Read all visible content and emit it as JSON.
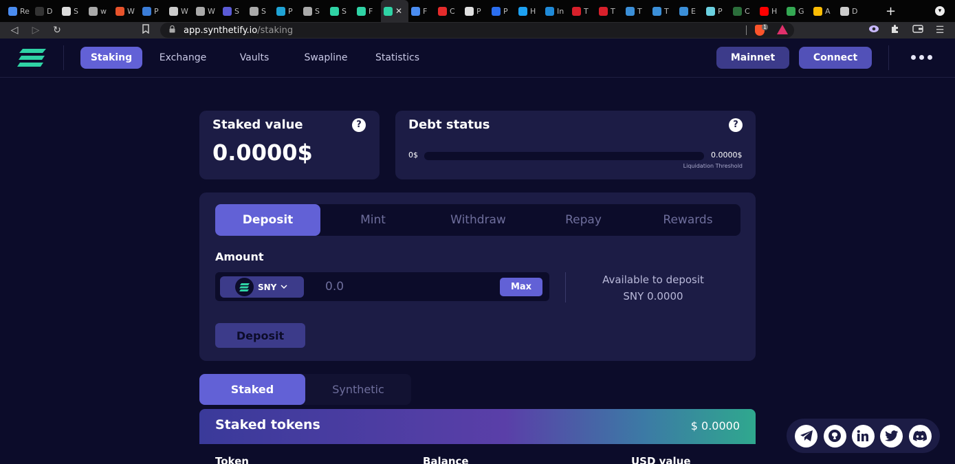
{
  "browser": {
    "tabs": [
      {
        "label": "Re",
        "color": "#4a8cf0"
      },
      {
        "label": "D",
        "color": "#333333"
      },
      {
        "label": "S",
        "color": "#dddddd"
      },
      {
        "label": "w",
        "color": "#aaaaaa"
      },
      {
        "label": "W",
        "color": "#e8532b"
      },
      {
        "label": "P",
        "color": "#3b7dd8"
      },
      {
        "label": "W",
        "color": "#cccccc"
      },
      {
        "label": "W",
        "color": "#aaaaaa"
      },
      {
        "label": "S",
        "color": "#5b5bd6"
      },
      {
        "label": "S",
        "color": "#aaaaaa"
      },
      {
        "label": "P",
        "color": "#1fa3d5"
      },
      {
        "label": "S",
        "color": "#aaaaaa"
      },
      {
        "label": "S",
        "color": "#2fd3a5"
      },
      {
        "label": "F",
        "color": "#2fd3a5"
      }
    ],
    "active_tab_close": "✕",
    "tabs_right": [
      {
        "label": "F",
        "color": "#4a8cf0"
      },
      {
        "label": "C",
        "color": "#e52b2b"
      },
      {
        "label": "P",
        "color": "#e0e0e0"
      },
      {
        "label": "P",
        "color": "#2b6ef0"
      },
      {
        "label": "H",
        "color": "#1da1f2"
      },
      {
        "label": "In",
        "color": "#1f8ad8"
      },
      {
        "label": "T",
        "color": "#d8202b"
      },
      {
        "label": "T",
        "color": "#d8202b"
      },
      {
        "label": "T",
        "color": "#3b8fd8"
      },
      {
        "label": "T",
        "color": "#3b8fd8"
      },
      {
        "label": "E",
        "color": "#3b8fd8"
      },
      {
        "label": "P",
        "color": "#6ad0e0"
      },
      {
        "label": "C",
        "color": "#2b6e3b"
      },
      {
        "label": "H",
        "color": "#ff0000"
      },
      {
        "label": "G",
        "color": "#34a853"
      },
      {
        "label": "A",
        "color": "#fbbc04"
      },
      {
        "label": "D",
        "color": "#cccccc"
      }
    ],
    "new_tab": "+",
    "url_host": "app.synthetify.io",
    "url_path": "/staking",
    "brave_badge": "1"
  },
  "header": {
    "nav": [
      "Staking",
      "Exchange",
      "Vaults",
      "Swapline",
      "Statistics"
    ],
    "network": "Mainnet",
    "connect": "Connect"
  },
  "staked_card": {
    "title": "Staked value",
    "value": "0.0000$",
    "help": "?"
  },
  "debt_card": {
    "title": "Debt status",
    "min": "0$",
    "max": "0.0000$",
    "threshold_label": "Liquidation Threshold",
    "help": "?"
  },
  "actions": {
    "tabs": [
      "Deposit",
      "Mint",
      "Withdraw",
      "Repay",
      "Rewards"
    ],
    "amount_label": "Amount",
    "token": "SNY",
    "amount_placeholder": "0.0",
    "max_label": "Max",
    "available_label": "Available to deposit",
    "available_value": "SNY 0.0000",
    "submit": "Deposit"
  },
  "positions": {
    "tabs": [
      "Staked",
      "Synthetic"
    ],
    "title": "Staked tokens",
    "total": "$ 0.0000",
    "columns": [
      "Token",
      "Balance",
      "USD value"
    ]
  },
  "social": [
    "telegram-icon",
    "github-icon",
    "linkedin-icon",
    "twitter-icon",
    "discord-icon"
  ]
}
